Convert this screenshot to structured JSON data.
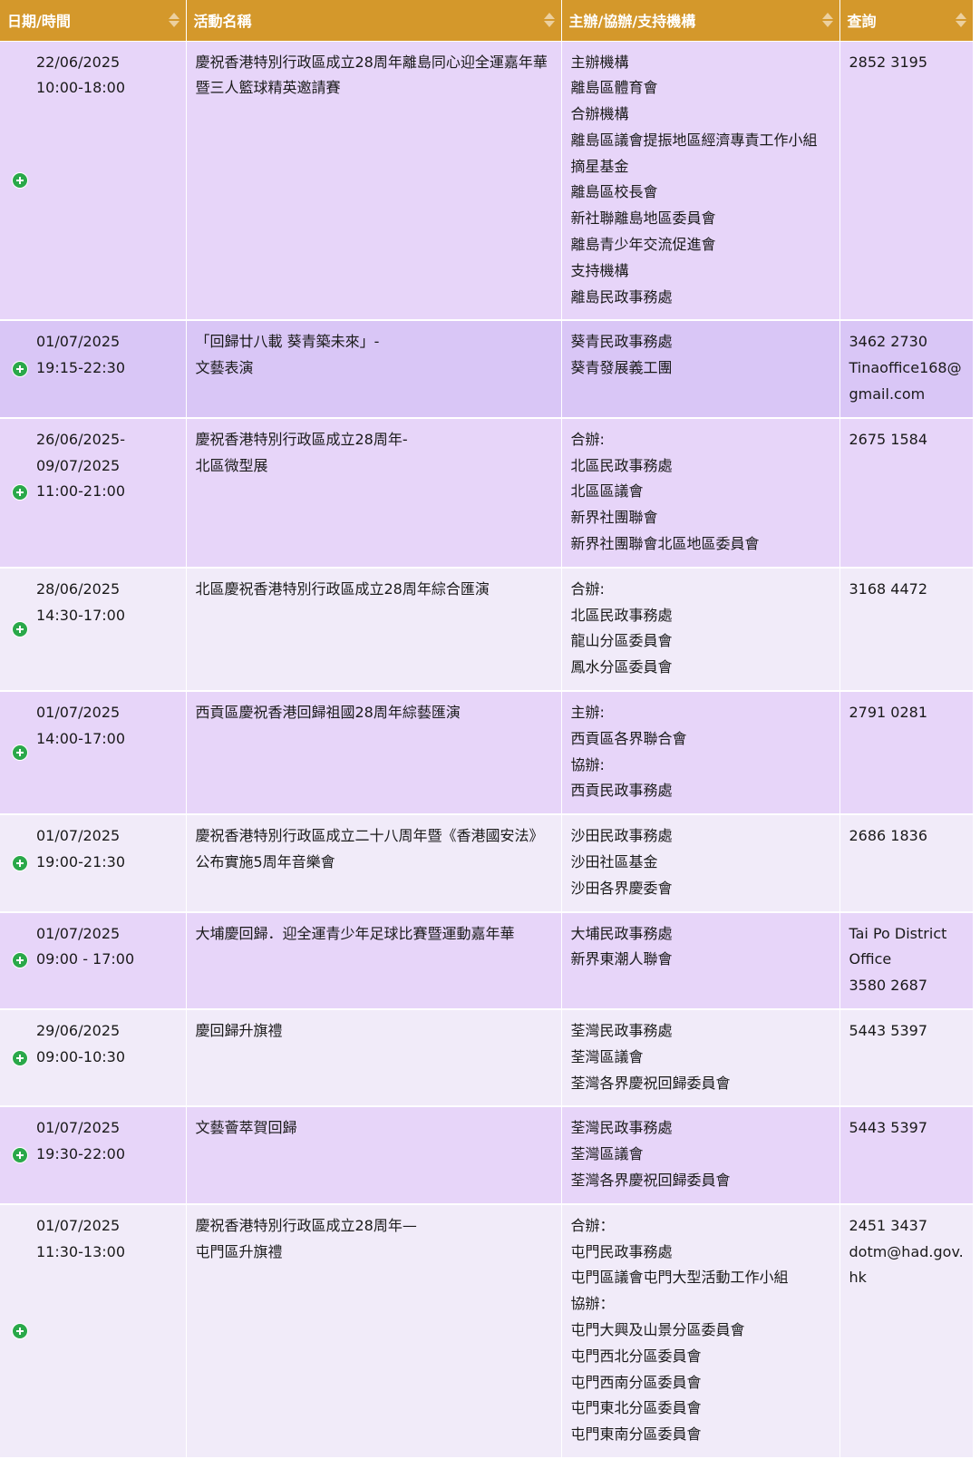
{
  "table": {
    "headers": [
      "日期/時間",
      "活動名稱",
      "主辦/協辦/支持機構",
      "查詢"
    ],
    "rows": [
      {
        "date": [
          "22/06/2025",
          "10:00-18:00"
        ],
        "name": [
          "慶祝香港特別行政區成立28周年離島同心迎全運嘉年華",
          "暨三人籃球精英邀請賽"
        ],
        "org": [
          "主辦機構",
          "離島區體育會",
          "合辦機構",
          "離島區議會提振地區經濟專責工作小組",
          "摘星基金",
          "離島區校長會",
          "新社聯離島地區委員會",
          "離島青少年交流促進會",
          "支持機構",
          "離島民政事務處"
        ],
        "inquiry": [
          "2852 3195"
        ]
      },
      {
        "date": [
          "01/07/2025",
          "19:15-22:30"
        ],
        "name": [
          "「回歸廿八載 葵青築未來」-",
          "文藝表演"
        ],
        "org": [
          "葵青民政事務處",
          "葵青發展義工團"
        ],
        "inquiry": [
          "3462 2730",
          "Tinaoffice168@",
          "gmail.com"
        ]
      },
      {
        "date": [
          "26/06/2025-",
          "09/07/2025",
          "11:00-21:00"
        ],
        "name": [
          "慶祝香港特別行政區成立28周年-",
          "北區微型展"
        ],
        "org": [
          "合辦:",
          "北區民政事務處",
          "北區區議會",
          "新界社團聯會",
          "新界社團聯會北區地區委員會"
        ],
        "inquiry": [
          "2675 1584"
        ]
      },
      {
        "date": [
          "28/06/2025",
          "14:30-17:00"
        ],
        "name": [
          "北區慶祝香港特別行政區成立28周年綜合匯演"
        ],
        "org": [
          "合辦:",
          "北區民政事務處",
          "龍山分區委員會",
          "鳳水分區委員會"
        ],
        "inquiry": [
          "3168 4472"
        ]
      },
      {
        "date": [
          "01/07/2025",
          "14:00-17:00"
        ],
        "name": [
          "西貢區慶祝香港回歸祖國28周年綜藝匯演"
        ],
        "org": [
          "主辦:",
          "西貢區各界聯合會",
          "協辦:",
          "西貢民政事務處"
        ],
        "inquiry": [
          "2791 0281"
        ]
      },
      {
        "date": [
          "01/07/2025",
          "19:00-21:30"
        ],
        "name": [
          "慶祝香港特別行政區成立二十八周年暨《香港國安法》",
          "公布實施5周年音樂會"
        ],
        "org": [
          "沙田民政事務處",
          "沙田社區基金",
          "沙田各界慶委會"
        ],
        "inquiry": [
          "2686 1836"
        ]
      },
      {
        "date": [
          "01/07/2025",
          "09:00 - 17:00"
        ],
        "name": [
          "大埔慶回歸．迎全運青少年足球比賽暨運動嘉年華"
        ],
        "org": [
          "大埔民政事務處",
          "新界東潮人聯會"
        ],
        "inquiry": [
          "Tai Po District",
          "Office",
          "3580 2687"
        ]
      },
      {
        "date": [
          "29/06/2025",
          "09:00-10:30"
        ],
        "name": [
          "慶回歸升旗禮"
        ],
        "org": [
          "荃灣民政事務處",
          "荃灣區議會",
          "荃灣各界慶祝回歸委員會"
        ],
        "inquiry": [
          "5443 5397"
        ]
      },
      {
        "date": [
          "01/07/2025",
          "19:30-22:00"
        ],
        "name": [
          "文藝薈萃賀回歸"
        ],
        "org": [
          "荃灣民政事務處",
          "荃灣區議會",
          "荃灣各界慶祝回歸委員會"
        ],
        "inquiry": [
          "5443 5397"
        ]
      },
      {
        "date": [
          "01/07/2025",
          "11:30-13:00"
        ],
        "name": [
          "慶祝香港特別行政區成立28周年—",
          "屯門區升旗禮"
        ],
        "org": [
          "合辦：",
          "屯門民政事務處",
          "屯門區議會屯門大型活動工作小組",
          "協辦：",
          "屯門大興及山景分區委員會",
          "屯門西北分區委員會",
          "屯門西南分區委員會",
          "屯門東北分區委員會",
          "屯門東南分區委員會"
        ],
        "inquiry": [
          "2451 3437",
          "dotm@had.gov.",
          "hk"
        ]
      }
    ]
  },
  "colors": {
    "header_bg": "#d4982b",
    "row_odd": "#e7d5f9",
    "row_even": "#f1ebf9",
    "row_highlight": "#d9c6f6",
    "expand_icon": "#2aa84a"
  },
  "icons": {
    "sort": "sort-both-icon",
    "expand": "plus-circle-icon"
  }
}
